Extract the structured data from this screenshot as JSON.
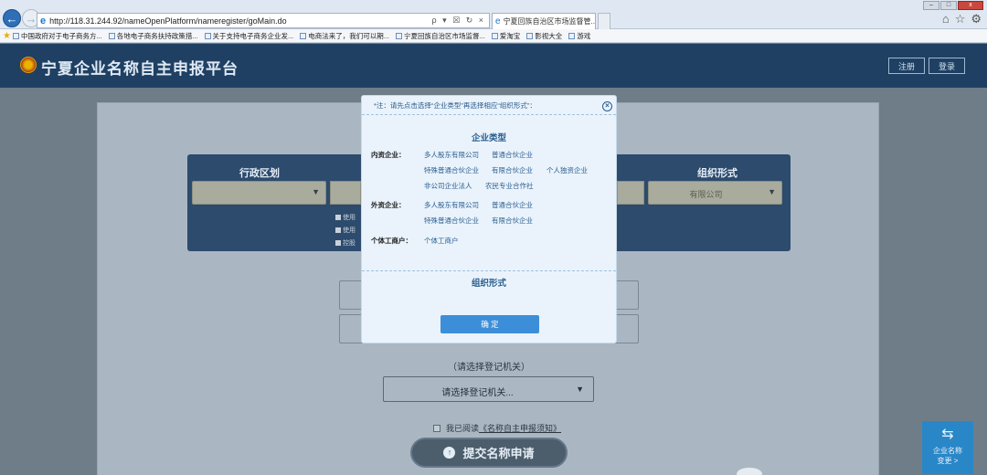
{
  "browser": {
    "url": "http://118.31.244.92/nameOpenPlatform/nameregister/goMain.do",
    "url_tools": "ρ ▾ ☒ ↻ ×",
    "tab_title": "宁夏回族自治区市场监督管...",
    "tab_close": "×",
    "favorites": [
      "中国政府对于电子商务方...",
      "各地电子商务扶持政策措...",
      "关于支持电子商务企业发...",
      "电商法来了，我们可以期...",
      "宁夏回族自治区市场监督...",
      "爱淘宝",
      "影视大全",
      "游戏"
    ]
  },
  "header": {
    "title": "宁夏企业名称自主申报平台",
    "register_label": "注册",
    "login_label": "登录"
  },
  "form": {
    "col_admin_region": "行政区划",
    "col_org_form": "组织形式",
    "org_form_value": "有限公司",
    "checkboxes": [
      "使用",
      "使用",
      "控股"
    ],
    "authority_prompt": "（请选择登记机关）",
    "authority_select_value": "请选择登记机关...",
    "agree_prefix": "我已阅读",
    "agree_link": "《名称自主申报须知》",
    "submit_label": "提交名称申请"
  },
  "side_widget": {
    "line1": "企业名称",
    "line2": "变更 >"
  },
  "modal": {
    "note": "*注：请先点击选择“企业类型”再选择相应“组织形式”：",
    "section_enterprise_type": "企业类型",
    "groups": {
      "domestic": {
        "label": "内资企业：",
        "options": [
          "多人股东有限公司",
          "普通合伙企业",
          "特殊普通合伙企业",
          "有限合伙企业",
          "个人独资企业",
          "非公司企业法人",
          "农民专业合作社"
        ]
      },
      "foreign": {
        "label": "外资企业：",
        "options": [
          "多人股东有限公司",
          "普通合伙企业",
          "特殊普通合伙企业",
          "有限合伙企业"
        ]
      },
      "individual": {
        "label": "个体工商户：",
        "options": [
          "个体工商户"
        ]
      }
    },
    "section_org_form": "组织形式",
    "confirm_label": "确 定"
  }
}
